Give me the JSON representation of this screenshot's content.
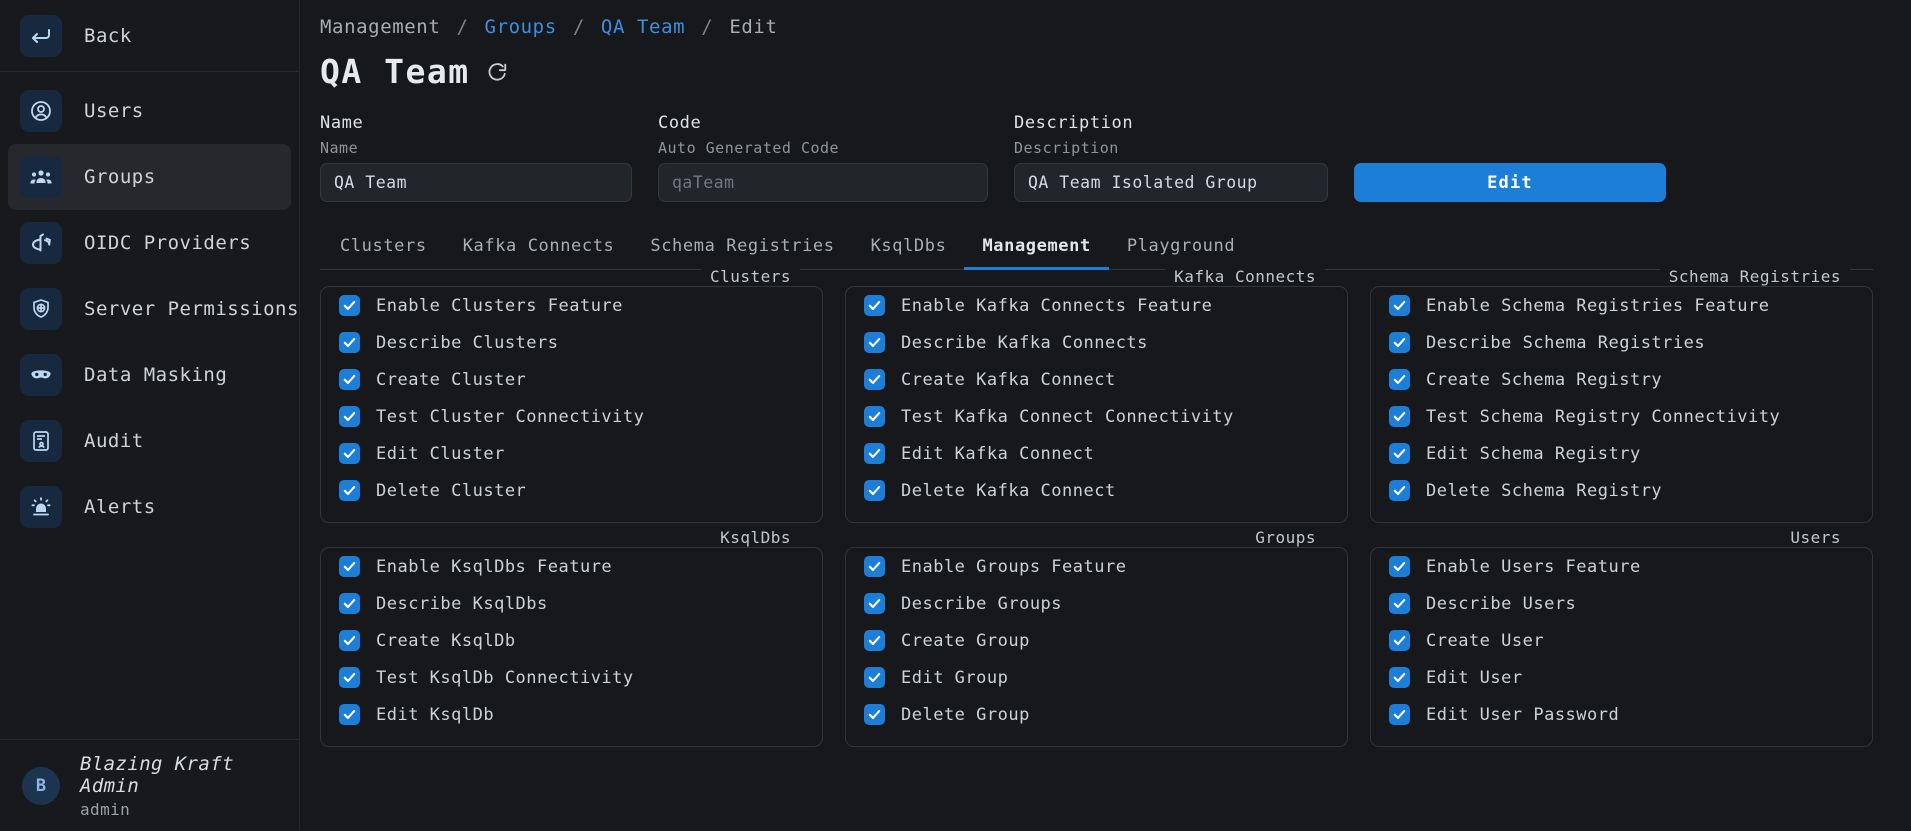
{
  "sidebar": {
    "back": {
      "label": "Back",
      "icon": "back-arrow-icon"
    },
    "items": [
      {
        "label": "Users",
        "icon": "user-circle-icon",
        "active": false
      },
      {
        "label": "Groups",
        "icon": "group-people-icon",
        "active": true
      },
      {
        "label": "OIDC Providers",
        "icon": "openid-icon",
        "active": false
      },
      {
        "label": "Server Permissions",
        "icon": "shield-globe-icon",
        "active": false
      },
      {
        "label": "Data Masking",
        "icon": "mask-icon",
        "active": false
      },
      {
        "label": "Audit",
        "icon": "audit-document-icon",
        "active": false
      },
      {
        "label": "Alerts",
        "icon": "alert-siren-icon",
        "active": false
      }
    ],
    "user": {
      "initial": "B",
      "name": "Blazing Kraft Admin",
      "role": "admin"
    }
  },
  "breadcrumb": {
    "root": "Management",
    "sep": "/",
    "groups": "Groups",
    "team": "QA Team",
    "current": "Edit"
  },
  "header": {
    "title": "QA Team",
    "refresh_icon": "refresh-icon"
  },
  "form": {
    "name": {
      "title": "Name",
      "sub": "Name",
      "value": "QA Team",
      "placeholder": "Name"
    },
    "code": {
      "title": "Code",
      "sub": "Auto Generated Code",
      "value": "",
      "placeholder": "qaTeam"
    },
    "desc": {
      "title": "Description",
      "sub": "Description",
      "value": "QA Team Isolated Group",
      "placeholder": "Description"
    },
    "edit_button": "Edit"
  },
  "tabs": [
    {
      "label": "Clusters",
      "active": false
    },
    {
      "label": "Kafka Connects",
      "active": false
    },
    {
      "label": "Schema Registries",
      "active": false
    },
    {
      "label": "KsqlDbs",
      "active": false
    },
    {
      "label": "Management",
      "active": true
    },
    {
      "label": "Playground",
      "active": false
    }
  ],
  "colors": {
    "accent": "#1c7ed6",
    "link": "#3b8fe0",
    "background": "#16181c",
    "sidebar_background": "#17191d",
    "card_border": "#31343a",
    "checkbox": "#1c7ed6"
  },
  "permission_cards": [
    {
      "legend": "Clusters",
      "options": [
        {
          "label": "Enable Clusters Feature",
          "checked": true
        },
        {
          "label": "Describe Clusters",
          "checked": true
        },
        {
          "label": "Create Cluster",
          "checked": true
        },
        {
          "label": "Test Cluster Connectivity",
          "checked": true
        },
        {
          "label": "Edit Cluster",
          "checked": true
        },
        {
          "label": "Delete Cluster",
          "checked": true
        }
      ]
    },
    {
      "legend": "Kafka Connects",
      "options": [
        {
          "label": "Enable Kafka Connects Feature",
          "checked": true
        },
        {
          "label": "Describe Kafka Connects",
          "checked": true
        },
        {
          "label": "Create Kafka Connect",
          "checked": true
        },
        {
          "label": "Test Kafka Connect Connectivity",
          "checked": true
        },
        {
          "label": "Edit Kafka Connect",
          "checked": true
        },
        {
          "label": "Delete Kafka Connect",
          "checked": true
        }
      ]
    },
    {
      "legend": "Schema Registries",
      "options": [
        {
          "label": "Enable Schema Registries Feature",
          "checked": true
        },
        {
          "label": "Describe Schema Registries",
          "checked": true
        },
        {
          "label": "Create Schema Registry",
          "checked": true
        },
        {
          "label": "Test Schema Registry Connectivity",
          "checked": true
        },
        {
          "label": "Edit Schema Registry",
          "checked": true
        },
        {
          "label": "Delete Schema Registry",
          "checked": true
        }
      ]
    },
    {
      "legend": "KsqlDbs",
      "options": [
        {
          "label": "Enable KsqlDbs Feature",
          "checked": true
        },
        {
          "label": "Describe KsqlDbs",
          "checked": true
        },
        {
          "label": "Create KsqlDb",
          "checked": true
        },
        {
          "label": "Test KsqlDb Connectivity",
          "checked": true
        },
        {
          "label": "Edit KsqlDb",
          "checked": true
        }
      ]
    },
    {
      "legend": "Groups",
      "options": [
        {
          "label": "Enable Groups Feature",
          "checked": true
        },
        {
          "label": "Describe Groups",
          "checked": true
        },
        {
          "label": "Create Group",
          "checked": true
        },
        {
          "label": "Edit Group",
          "checked": true
        },
        {
          "label": "Delete Group",
          "checked": true
        }
      ]
    },
    {
      "legend": "Users",
      "options": [
        {
          "label": "Enable Users Feature",
          "checked": true
        },
        {
          "label": "Describe Users",
          "checked": true
        },
        {
          "label": "Create User",
          "checked": true
        },
        {
          "label": "Edit User",
          "checked": true
        },
        {
          "label": "Edit User Password",
          "checked": true
        }
      ]
    }
  ]
}
